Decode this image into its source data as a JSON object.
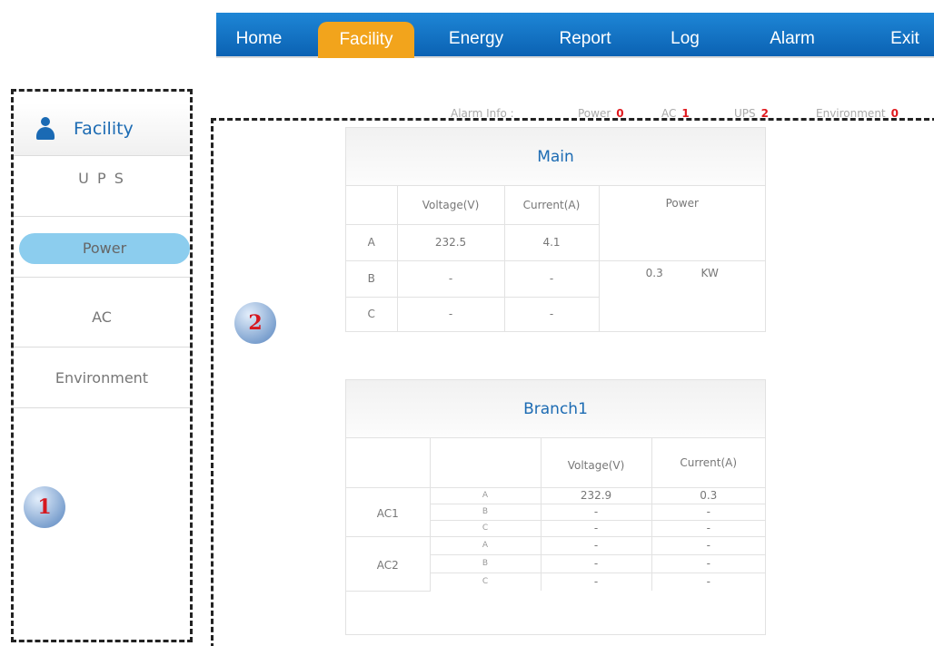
{
  "nav": {
    "items": [
      {
        "label": "Home"
      },
      {
        "label": "Facility",
        "active": true
      },
      {
        "label": "Energy"
      },
      {
        "label": "Report"
      },
      {
        "label": "Log"
      },
      {
        "label": "Alarm"
      },
      {
        "label": "Exit"
      }
    ]
  },
  "alarm_info": {
    "label": "Alarm Info :",
    "items": [
      {
        "label": "Power",
        "count": "0"
      },
      {
        "label": "AC",
        "count": "1"
      },
      {
        "label": "UPS",
        "count": "2"
      },
      {
        "label": "Environment",
        "count": "0"
      }
    ]
  },
  "sidebar": {
    "header": "Facility",
    "items": [
      {
        "label": "U P S"
      },
      {
        "label": "Power",
        "active": true
      },
      {
        "label": "AC"
      },
      {
        "label": "Environment"
      }
    ]
  },
  "markers": {
    "sidebar": "1",
    "content": "2"
  },
  "main_table": {
    "title": "Main",
    "headers": [
      "Voltage(V)",
      "Current(A)",
      "Power"
    ],
    "rows": [
      {
        "phase": "A",
        "voltage": "232.5",
        "current": "4.1"
      },
      {
        "phase": "B",
        "voltage": "-",
        "current": "-"
      },
      {
        "phase": "C",
        "voltage": "-",
        "current": "-"
      }
    ],
    "power_value": "0.3",
    "power_unit": "KW"
  },
  "branch_table": {
    "title": "Branch1",
    "headers": [
      "Voltage(V)",
      "Current(A)"
    ],
    "groups": [
      {
        "name": "AC1",
        "rows": [
          {
            "phase": "A",
            "voltage": "232.9",
            "current": "0.3"
          },
          {
            "phase": "B",
            "voltage": "-",
            "current": "-"
          },
          {
            "phase": "C",
            "voltage": "-",
            "current": "-"
          }
        ]
      },
      {
        "name": "AC2",
        "rows": [
          {
            "phase": "A",
            "voltage": "-",
            "current": "-"
          },
          {
            "phase": "B",
            "voltage": "-",
            "current": "-"
          },
          {
            "phase": "C",
            "voltage": "-",
            "current": "-"
          }
        ]
      }
    ]
  },
  "colors": {
    "nav_blue": "#0b62b3",
    "nav_active": "#f2a41c",
    "title_blue": "#1c6bb3",
    "alarm_red": "#e0191e",
    "pill_blue": "#8ccdee"
  }
}
